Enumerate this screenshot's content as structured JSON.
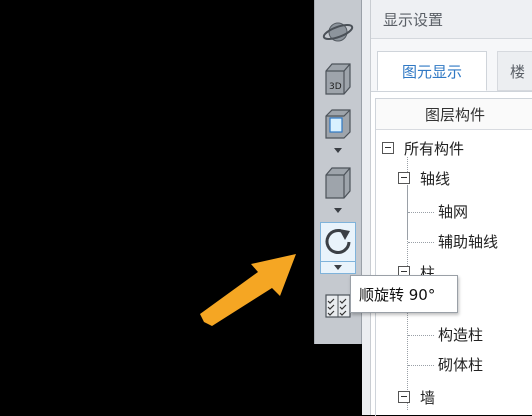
{
  "panel": {
    "title": "显示设置",
    "tabs": [
      {
        "label": "图元显示",
        "active": true
      },
      {
        "label": "楼",
        "active": false
      }
    ],
    "tree": {
      "column_header": "图层构件",
      "rows": [
        {
          "label": "所有构件",
          "level": 0,
          "toggle": "-"
        },
        {
          "label": "轴线",
          "level": 1,
          "toggle": "-"
        },
        {
          "label": "轴网",
          "level": 2
        },
        {
          "label": "辅助轴线",
          "level": 2
        },
        {
          "label": "柱",
          "level": 1,
          "toggle": "-"
        },
        {
          "label": "构造柱",
          "level": 2
        },
        {
          "label": "砌体柱",
          "level": 2
        },
        {
          "label": "墙",
          "level": 1,
          "toggle": "-"
        }
      ]
    }
  },
  "toolbar": {
    "buttons": [
      {
        "name": "orbit",
        "icon": "orbit-planet-icon"
      },
      {
        "name": "view-3d",
        "icon": "cube-3d-icon",
        "label": "3D"
      },
      {
        "name": "view-top",
        "icon": "cube-top-icon"
      },
      {
        "name": "view-side",
        "icon": "cube-side-icon"
      },
      {
        "name": "rotate-90",
        "icon": "rotate-clockwise-icon",
        "active": true
      },
      {
        "name": "layer-list",
        "icon": "checklist-icon"
      }
    ]
  },
  "tooltip": {
    "text": "顺旋转 90°"
  },
  "colors": {
    "accent_tab": "#2f78c4",
    "annotation_arrow": "#f5a623",
    "active_button_bg": "#e9f3fb"
  }
}
